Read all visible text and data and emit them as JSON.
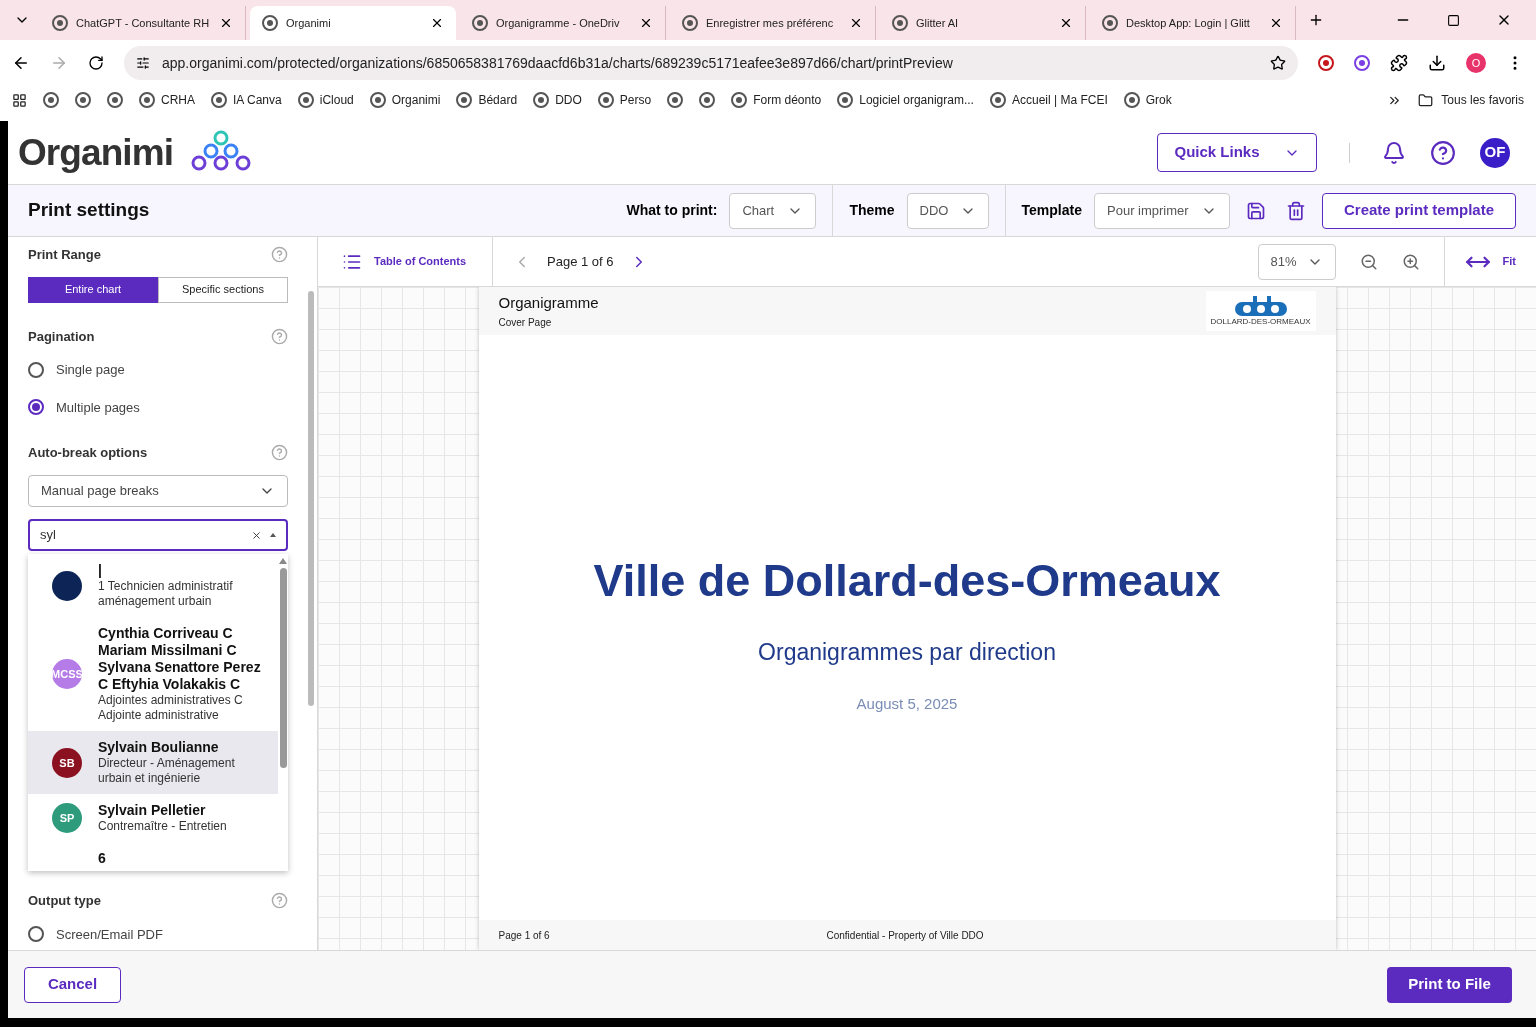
{
  "browser": {
    "tabs": [
      {
        "title": "ChatGPT - Consultante RH",
        "selected": false
      },
      {
        "title": "Organimi",
        "selected": true
      },
      {
        "title": "Organigramme - OneDriv",
        "selected": false
      },
      {
        "title": "Enregistrer mes préférenc",
        "selected": false
      },
      {
        "title": "Glitter AI",
        "selected": false
      },
      {
        "title": "Desktop App: Login | Glitt",
        "selected": false
      }
    ],
    "url": "app.organimi.com/protected/organizations/6850658381769daacfd6b31a/charts/689239c5171eafee3e897d66/chart/printPreview",
    "profile_initial": "O",
    "bookmarks": [
      {
        "kind": "icon"
      },
      {
        "kind": "icon"
      },
      {
        "kind": "icon"
      },
      {
        "kind": "link",
        "label": "CRHA"
      },
      {
        "kind": "link",
        "label": "IA Canva"
      },
      {
        "kind": "link",
        "label": "iCloud"
      },
      {
        "kind": "link",
        "label": "Organimi"
      },
      {
        "kind": "link",
        "label": "Bédard"
      },
      {
        "kind": "link",
        "label": "DDO"
      },
      {
        "kind": "link",
        "label": "Perso"
      },
      {
        "kind": "icon"
      },
      {
        "kind": "icon"
      },
      {
        "kind": "link",
        "label": "Form déonto"
      },
      {
        "kind": "link",
        "label": "Logiciel organigram..."
      },
      {
        "kind": "link",
        "label": "Accueil | Ma FCEI"
      },
      {
        "kind": "link",
        "label": "Grok"
      }
    ],
    "all_bookmarks": "Tous les favoris"
  },
  "header": {
    "brand": "Organimi",
    "quick_links": "Quick Links",
    "avatar": "OF"
  },
  "toolbar": {
    "title": "Print settings",
    "what_label": "What to print:",
    "what_value": "Chart",
    "theme_label": "Theme",
    "theme_value": "DDO",
    "template_label": "Template",
    "template_value": "Pour imprimer",
    "create_button": "Create print template"
  },
  "settings": {
    "print_range": {
      "label": "Print Range",
      "options": [
        {
          "label": "Entire chart",
          "selected": true
        },
        {
          "label": "Specific sections",
          "selected": false
        }
      ]
    },
    "pagination": {
      "label": "Pagination",
      "options": [
        {
          "label": "Single page",
          "selected": false
        },
        {
          "label": "Multiple pages",
          "selected": true
        }
      ]
    },
    "auto_break": {
      "label": "Auto-break options",
      "value": "Manual page breaks"
    },
    "search": {
      "value": "syl"
    },
    "results": [
      {
        "name": "|",
        "title": "1 Technicien administratif aménagement urbain",
        "color": "#0d2556",
        "highlighted": false
      },
      {
        "name": "Cynthia Corriveau C Mariam Missilmani C Sylvana Senattore Perez C Eftyhia Volakakis C",
        "title": "Adjointes administratives C Adjointe administrative",
        "initials": "MCSS",
        "color": "#b57be6",
        "highlighted": false
      },
      {
        "name": "Sylvain Boulianne",
        "title": "Directeur - Aménagement urbain et ingénierie",
        "initials": "SB",
        "color": "#8b1020",
        "highlighted": true
      },
      {
        "name": "Sylvain Pelletier",
        "title": "Contremaître - Entretien",
        "initials": "SP",
        "color": "#2e9b7d",
        "highlighted": false
      },
      {
        "name": "6",
        "highlighted": false
      }
    ],
    "output": {
      "label": "Output type",
      "options": [
        {
          "label": "Screen/Email PDF",
          "selected": false
        }
      ]
    }
  },
  "preview_bar": {
    "toc": "Table of Contents",
    "page": "Page 1 of 6",
    "zoom": "81%",
    "fit": "Fit"
  },
  "page": {
    "header_title": "Organigramme",
    "header_subtitle": "Cover Page",
    "logo_text": "DOLLARD-DES-ORMEAUX",
    "title": "Ville de Dollard-des-Ormeaux",
    "subtitle": "Organigrammes par direction",
    "date": "August 5, 2025",
    "footer_page": "Page 1 of 6",
    "footer_note": "Confidential - Property of Ville DDO"
  },
  "footer": {
    "cancel": "Cancel",
    "print": "Print to File"
  }
}
